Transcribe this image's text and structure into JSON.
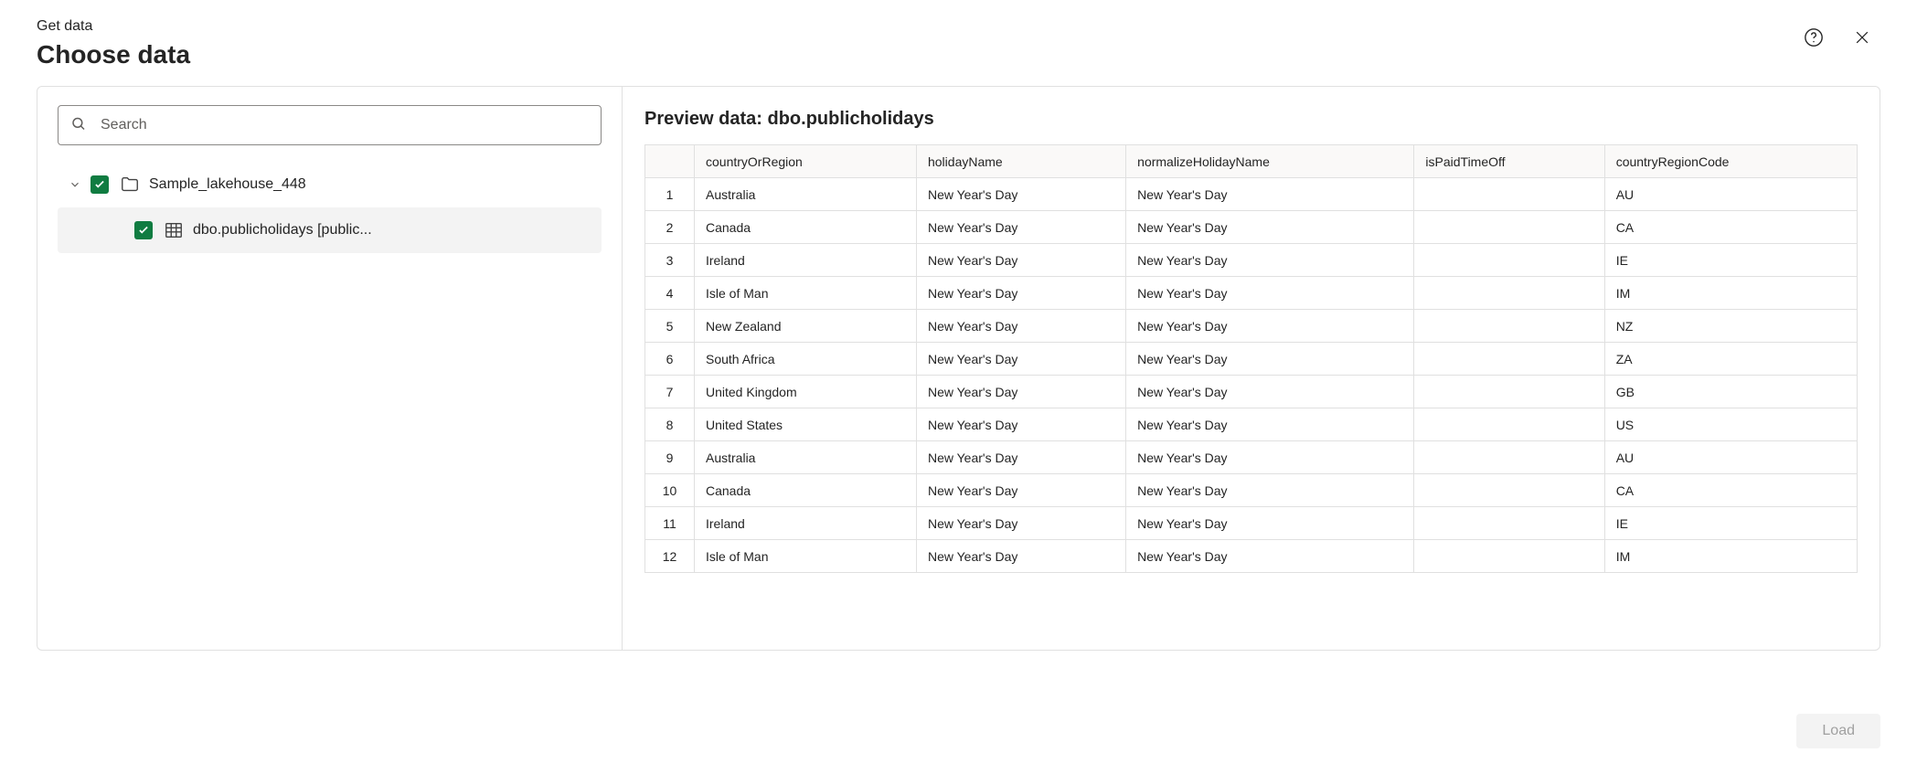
{
  "header": {
    "breadcrumb": "Get data",
    "title": "Choose data"
  },
  "search": {
    "placeholder": "Search",
    "value": ""
  },
  "tree": {
    "root": {
      "label": "Sample_lakehouse_448",
      "checked": true
    },
    "child": {
      "label": "dbo.publicholidays [public...",
      "checked": true
    }
  },
  "preview": {
    "title": "Preview data: dbo.publicholidays",
    "columns": [
      "countryOrRegion",
      "holidayName",
      "normalizeHolidayName",
      "isPaidTimeOff",
      "countryRegionCode"
    ],
    "rows": [
      {
        "n": "1",
        "countryOrRegion": "Australia",
        "holidayName": "New Year's Day",
        "normalizeHolidayName": "New Year's Day",
        "isPaidTimeOff": "",
        "countryRegionCode": "AU"
      },
      {
        "n": "2",
        "countryOrRegion": "Canada",
        "holidayName": "New Year's Day",
        "normalizeHolidayName": "New Year's Day",
        "isPaidTimeOff": "",
        "countryRegionCode": "CA"
      },
      {
        "n": "3",
        "countryOrRegion": "Ireland",
        "holidayName": "New Year's Day",
        "normalizeHolidayName": "New Year's Day",
        "isPaidTimeOff": "",
        "countryRegionCode": "IE"
      },
      {
        "n": "4",
        "countryOrRegion": "Isle of Man",
        "holidayName": "New Year's Day",
        "normalizeHolidayName": "New Year's Day",
        "isPaidTimeOff": "",
        "countryRegionCode": "IM"
      },
      {
        "n": "5",
        "countryOrRegion": "New Zealand",
        "holidayName": "New Year's Day",
        "normalizeHolidayName": "New Year's Day",
        "isPaidTimeOff": "",
        "countryRegionCode": "NZ"
      },
      {
        "n": "6",
        "countryOrRegion": "South Africa",
        "holidayName": "New Year's Day",
        "normalizeHolidayName": "New Year's Day",
        "isPaidTimeOff": "",
        "countryRegionCode": "ZA"
      },
      {
        "n": "7",
        "countryOrRegion": "United Kingdom",
        "holidayName": "New Year's Day",
        "normalizeHolidayName": "New Year's Day",
        "isPaidTimeOff": "",
        "countryRegionCode": "GB"
      },
      {
        "n": "8",
        "countryOrRegion": "United States",
        "holidayName": "New Year's Day",
        "normalizeHolidayName": "New Year's Day",
        "isPaidTimeOff": "",
        "countryRegionCode": "US"
      },
      {
        "n": "9",
        "countryOrRegion": "Australia",
        "holidayName": "New Year's Day",
        "normalizeHolidayName": "New Year's Day",
        "isPaidTimeOff": "",
        "countryRegionCode": "AU"
      },
      {
        "n": "10",
        "countryOrRegion": "Canada",
        "holidayName": "New Year's Day",
        "normalizeHolidayName": "New Year's Day",
        "isPaidTimeOff": "",
        "countryRegionCode": "CA"
      },
      {
        "n": "11",
        "countryOrRegion": "Ireland",
        "holidayName": "New Year's Day",
        "normalizeHolidayName": "New Year's Day",
        "isPaidTimeOff": "",
        "countryRegionCode": "IE"
      },
      {
        "n": "12",
        "countryOrRegion": "Isle of Man",
        "holidayName": "New Year's Day",
        "normalizeHolidayName": "New Year's Day",
        "isPaidTimeOff": "",
        "countryRegionCode": "IM"
      }
    ]
  },
  "footer": {
    "load_label": "Load"
  }
}
